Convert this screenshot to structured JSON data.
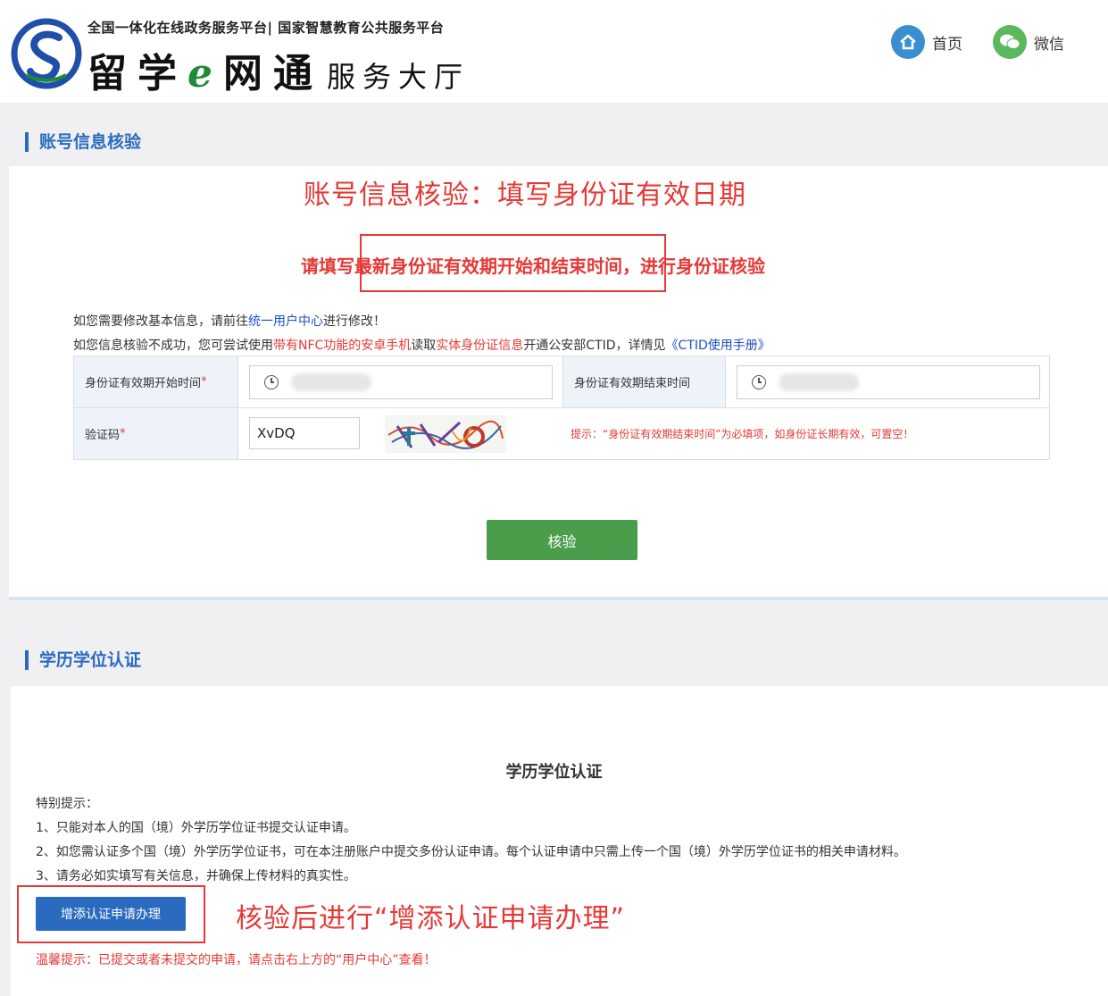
{
  "header": {
    "platform_line": "全国一体化在线政务服务平台| 国家智慧教育公共服务平台",
    "brand_main_1": "留学",
    "brand_e": "e",
    "brand_main_2": "网通",
    "brand_sub": "服务大厅",
    "nav": {
      "home": "首页",
      "wechat": "微信"
    }
  },
  "section1": {
    "heading": "账号信息核验",
    "annotation_title": "账号信息核验：填写身份证有效日期",
    "instruction": "请填写最新身份证有效期开始和结束时间，进行身份证核验",
    "notice1": {
      "pre": "如您需要修改基本信息，请前往",
      "link": "统一用户中心",
      "post": "进行修改！"
    },
    "notice2": {
      "p1": "如您信息核验不成功，您可尝试使用",
      "r1": "带有NFC功能的安卓手机",
      "p2": "读取",
      "r2": "实体身份证信息",
      "p3": "开通公安部CTID，详情见",
      "link": "《CTID使用手册》"
    },
    "form": {
      "start_label": "身份证有效期开始时间",
      "end_label": "身份证有效期结束时间",
      "captcha_label": "验证码",
      "required_mark": "*",
      "captcha_value": "XvDQ",
      "hint": "提示：“身份证有效期结束时间”为必填项，如身份证长期有效，可置空！"
    },
    "verify_button": "核验"
  },
  "section2": {
    "heading": "学历学位认证",
    "card_title": "学历学位认证",
    "tips_title": "特别提示：",
    "tip1": "1、只能对本人的国（境）外学历学位证书提交认证申请。",
    "tip2": "2、如您需认证多个国（境）外学历学位证书，可在本注册账户中提交多份认证申请。每个认证申请中只需上传一个国（境）外学历学位证书的相关申请材料。",
    "tip3": "3、请务必如实填写有关信息，并确保上传材料的真实性。",
    "add_button": "增添认证申请办理",
    "annotation": "核验后进行“增添认证申请办理”",
    "warm_tip": "温馨提示：已提交或者未提交的申请，请点击右上方的“用户中心”查看！"
  },
  "colors": {
    "accent_blue": "#2a6bbf",
    "verify_green": "#4a9d4a",
    "annotation_red": "#e53935"
  },
  "icons": [
    "logo-emblem",
    "home-icon",
    "wechat-icon",
    "clock-icon",
    "captcha-image"
  ]
}
